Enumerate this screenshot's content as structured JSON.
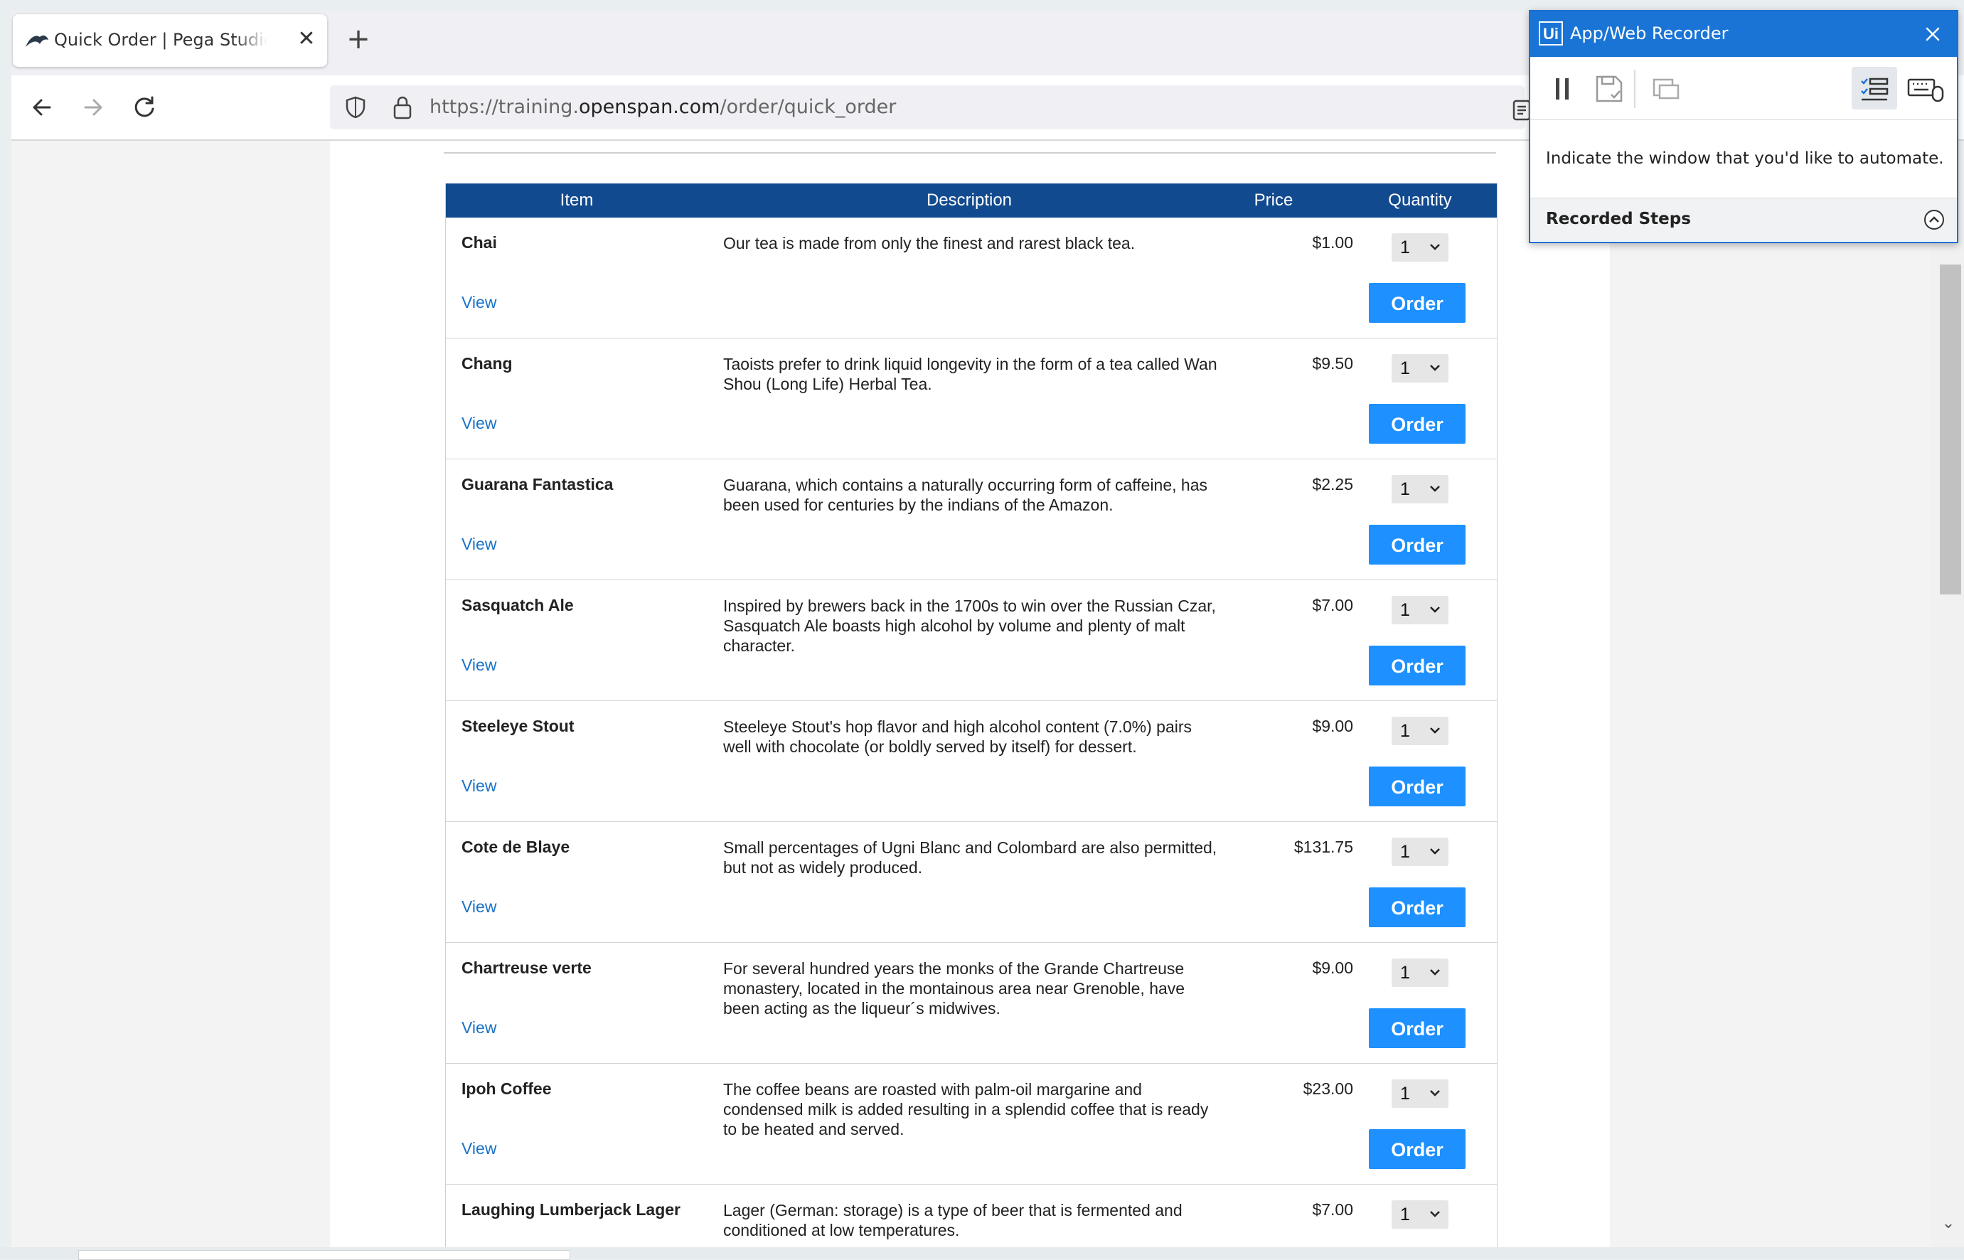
{
  "browser": {
    "tab_title": "Quick Order | Pega Studio Training",
    "url_prefix": "https://training.",
    "url_domain": "openspan.com",
    "url_path": "/order/quick_order"
  },
  "table": {
    "headers": {
      "item": "Item",
      "description": "Description",
      "price": "Price",
      "quantity": "Quantity"
    },
    "view_label": "View",
    "order_label": "Order",
    "rows": [
      {
        "name": "Chai",
        "description": "Our tea is made from only the finest and rarest black tea.",
        "price": "$1.00",
        "qty": "1"
      },
      {
        "name": "Chang",
        "description": "Taoists prefer to drink liquid longevity in the form of a tea called Wan Shou (Long Life) Herbal Tea.",
        "price": "$9.50",
        "qty": "1"
      },
      {
        "name": "Guarana Fantastica",
        "description": "Guarana, which contains a naturally occurring form of caffeine, has been used for centuries by the indians of the Amazon.",
        "price": "$2.25",
        "qty": "1"
      },
      {
        "name": "Sasquatch Ale",
        "description": "Inspired by brewers back in the 1700s to win over the Russian Czar, Sasquatch Ale boasts high alcohol by volume and plenty of malt character.",
        "price": "$7.00",
        "qty": "1"
      },
      {
        "name": "Steeleye Stout",
        "description": "Steeleye Stout's hop flavor and high alcohol content (7.0%) pairs well with chocolate (or boldly served by itself) for dessert.",
        "price": "$9.00",
        "qty": "1"
      },
      {
        "name": "Cote de Blaye",
        "description": "Small percentages of Ugni Blanc and Colombard are also permitted, but not as widely produced.",
        "price": "$131.75",
        "qty": "1"
      },
      {
        "name": "Chartreuse verte",
        "description": "For several hundred years the monks of the Grande Chartreuse monastery, located in the montainous area near Grenoble, have been acting as the liqueur´s midwives.",
        "price": "$9.00",
        "qty": "1"
      },
      {
        "name": "Ipoh Coffee",
        "description": "The coffee beans are roasted with palm-oil margarine and condensed milk is added resulting in a splendid coffee that is ready to be heated and served.",
        "price": "$23.00",
        "qty": "1"
      },
      {
        "name": "Laughing Lumberjack Lager",
        "description": "Lager (German: storage) is a type of beer that is fermented and conditioned at low temperatures.",
        "price": "$7.00",
        "qty": "1"
      }
    ]
  },
  "recorder": {
    "logo": "Ui",
    "title": "App/Web Recorder",
    "message": "Indicate the window that you'd like to automate.",
    "steps_label": "Recorded Steps"
  },
  "colors": {
    "table_header": "#124a8f",
    "order_button": "#1e90ff",
    "link": "#1a73c8",
    "recorder_accent": "#1a74d6"
  }
}
